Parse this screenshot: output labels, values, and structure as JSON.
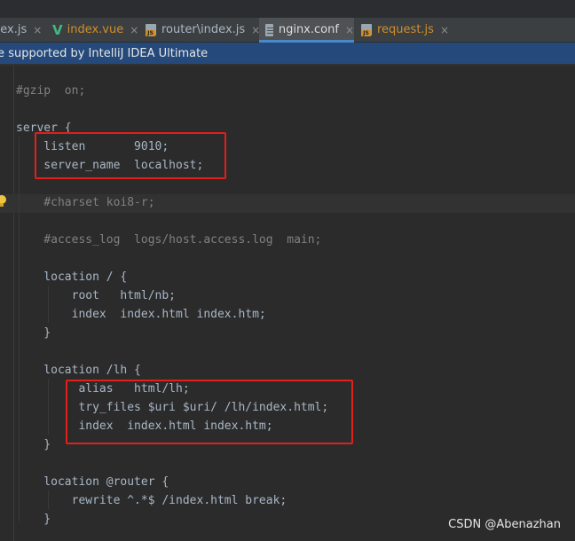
{
  "tabs": [
    {
      "label": "dex.js",
      "icon": "js-file-icon",
      "active": false
    },
    {
      "label": "index.vue",
      "icon": "vue-icon",
      "active": false
    },
    {
      "label": "router\\index.js",
      "icon": "js-file-icon",
      "active": false
    },
    {
      "label": "nginx.conf",
      "icon": "config-file-icon",
      "active": true
    },
    {
      "label": "request.js",
      "icon": "js-file-icon",
      "active": false
    }
  ],
  "close_glyph": "×",
  "banner": {
    "text": "re supported by IntelliJ IDEA Ultimate"
  },
  "code_lines": [
    "#gzip  on;",
    "",
    "server {",
    "    listen       9010;",
    "    server_name  localhost;",
    "",
    "    #charset koi8-r;",
    "",
    "    #access_log  logs/host.access.log  main;",
    "",
    "    location / {",
    "        root   html/nb;",
    "        index  index.html index.htm;",
    "    }",
    "",
    "    location /lh {",
    "         alias   html/lh;",
    "         try_files $uri $uri/ /lh/index.html;",
    "         index  index.html index.htm;",
    "    }",
    "",
    "    location @router {",
    "        rewrite ^.*$ /index.html break;",
    "    }"
  ],
  "watermark": "CSDN @Abenazhan",
  "colors": {
    "editor_bg": "#2b2b2b",
    "banner_bg": "#24497a",
    "highlight_box": "#e0201a",
    "code_text": "#a9b7c6",
    "comment_text": "#808080"
  }
}
